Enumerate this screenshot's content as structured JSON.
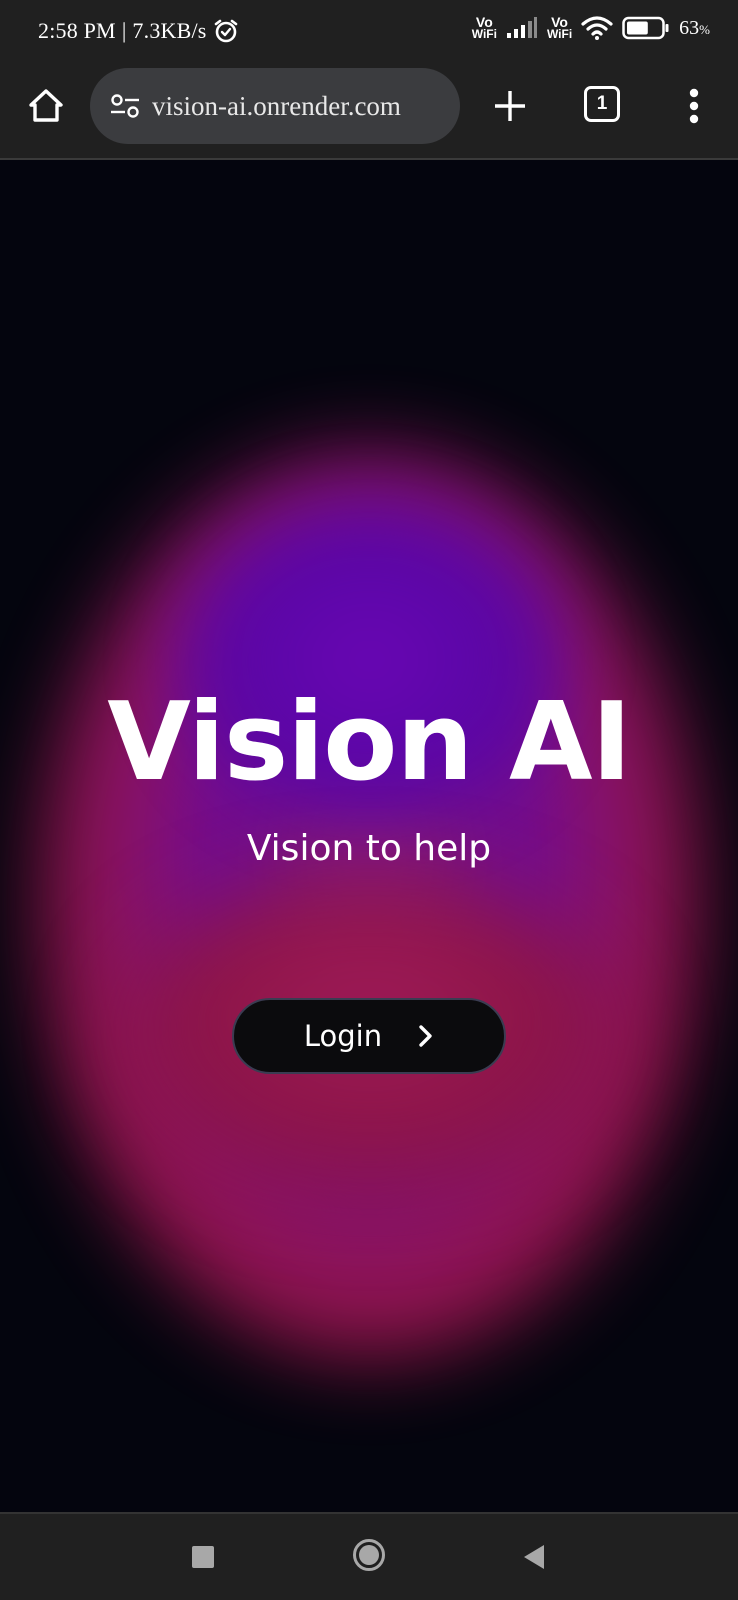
{
  "status_bar": {
    "time": "2:58 PM",
    "separator": "|",
    "net_speed": "7.3KB/s",
    "vowifi_1_top": "Vo",
    "vowifi_1_bottom": "WiFi",
    "vowifi_2_top": "Vo",
    "vowifi_2_bottom": "WiFi",
    "battery_percent": "63",
    "battery_unit": "%",
    "battery_level": 0.63
  },
  "browser": {
    "url": "vision-ai.onrender.com",
    "tab_count": "1"
  },
  "page": {
    "title": "Vision AI",
    "subtitle": "Vision to help",
    "login_label": "Login"
  },
  "colors": {
    "status_bar_bg": "#202020",
    "page_bg": "#04050e",
    "glow_purple": "#6a06b4",
    "glow_magenta": "#971548",
    "button_bg": "#0b0b0d"
  },
  "icons": {
    "home": "home-icon",
    "site_settings": "tune-icon",
    "new_tab": "plus-icon",
    "menu": "more-vert-icon",
    "alarm": "alarm-icon",
    "signal": "signal-icon",
    "wifi": "wifi-icon",
    "battery": "battery-icon",
    "chevron": "chevron-right-icon"
  }
}
